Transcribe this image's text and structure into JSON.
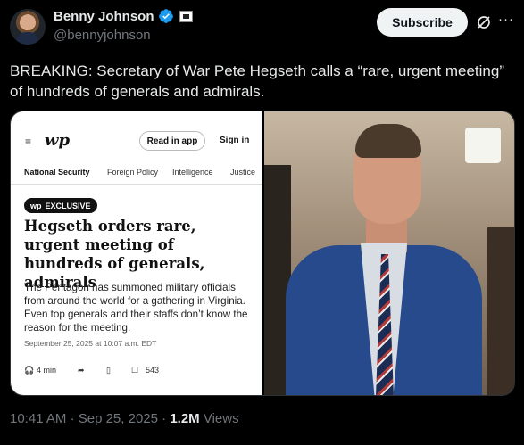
{
  "author": {
    "display_name": "Benny Johnson",
    "handle": "@bennyjohnson"
  },
  "header": {
    "subscribe_label": "Subscribe",
    "more_label": "···"
  },
  "tweet": {
    "text": "BREAKING: Secretary of War Pete Hegseth calls a “rare, urgent meeting” of hundreds of generals and admirals."
  },
  "article": {
    "menu_icon": "≡",
    "logo": "wp",
    "read_in_app": "Read in app",
    "sign_in": "Sign in",
    "nav": [
      "National Security",
      "Foreign Policy",
      "Intelligence",
      "Justice"
    ],
    "badge": "EXCLUSIVE",
    "badge_logo": "wp",
    "headline": "Hegseth orders rare, urgent meeting of hundreds of generals, admirals",
    "dek": "The Pentagon has summoned military officials from around the world for a gathering in Virginia. Even top generals and their staffs don’t know the reason for the meeting.",
    "date": "September 25, 2025 at 10:07 a.m. EDT",
    "read_time": "4 min",
    "comments": "543"
  },
  "meta": {
    "time": "10:41 AM",
    "separator1": "·",
    "date": "Sep 25, 2025",
    "separator2": "·",
    "views_count": "1.2M",
    "views_label": "Views"
  },
  "colors": {
    "background": "#000000",
    "text": "#e7e9ea",
    "secondary": "#71767b",
    "verified": "#1d9bf0"
  }
}
